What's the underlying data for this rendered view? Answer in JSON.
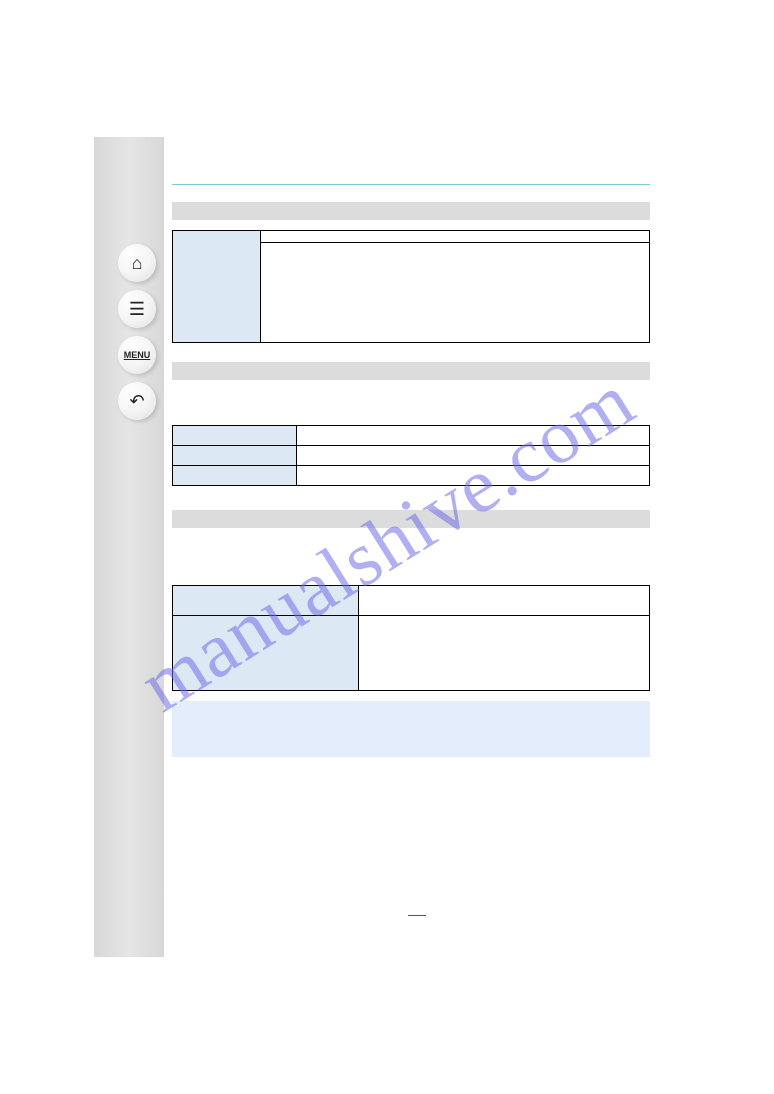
{
  "watermark": "manualshive.com",
  "nav": {
    "home": "⌂",
    "list": "☰",
    "menu": "MENU",
    "back": "↶"
  }
}
